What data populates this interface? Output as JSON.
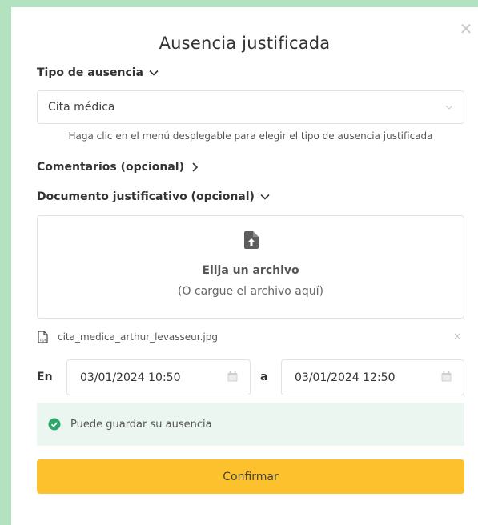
{
  "dialog": {
    "title": "Ausencia justificada",
    "close_glyph": "✕"
  },
  "absence_type": {
    "label": "Tipo de ausencia",
    "selected": "Cita médica",
    "hint": "Haga clic en el menú desplegable para elegir el tipo de ausencia justificada"
  },
  "comments": {
    "label": "Comentarios (opcional)"
  },
  "document": {
    "label": "Documento justificativo (opcional)",
    "dropzone_title": "Elija un archivo",
    "dropzone_subtitle": "(O cargue el archivo aquí)",
    "attached_file": "cita_medica_arthur_levasseur.jpg",
    "remove_glyph": "×"
  },
  "dates": {
    "from_label": "En",
    "from_value": "03/01/2024 10:50",
    "to_label": "a",
    "to_value": "03/01/2024 12:50"
  },
  "status": {
    "message": "Puede guardar su ausencia",
    "color": "#2ea66b"
  },
  "actions": {
    "confirm_label": "Confirmar",
    "confirm_color": "#fcc12d"
  },
  "icons": {
    "close": "close-icon",
    "chevron_down": "chevron-down-icon",
    "chevron_right": "chevron-right-icon",
    "upload": "file-upload-icon",
    "pdf": "pdf-file-icon",
    "calendar": "calendar-icon",
    "success": "check-circle-icon"
  }
}
